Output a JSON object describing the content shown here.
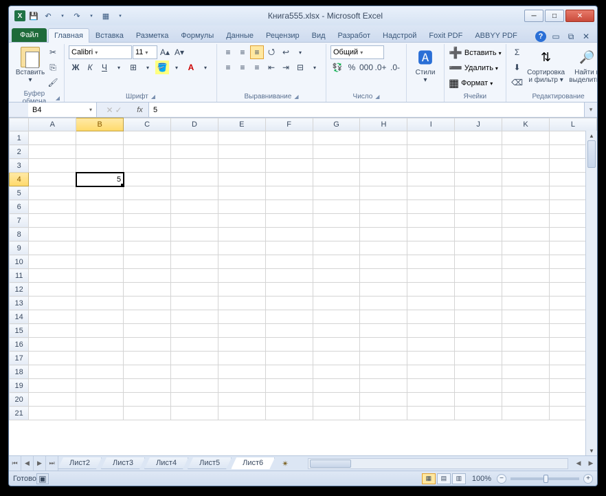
{
  "title": "Книга555.xlsx - Microsoft Excel",
  "file_tab": "Файл",
  "tabs": [
    "Главная",
    "Вставка",
    "Разметка",
    "Формулы",
    "Данные",
    "Рецензир",
    "Вид",
    "Разработ",
    "Надстрой",
    "Foxit PDF",
    "ABBYY PDF"
  ],
  "active_tab_index": 0,
  "ribbon": {
    "clipboard": {
      "paste": "Вставить",
      "label": "Буфер обмена"
    },
    "font": {
      "name": "Calibri",
      "size": "11",
      "label": "Шрифт"
    },
    "alignment": {
      "label": "Выравнивание"
    },
    "number": {
      "format": "Общий",
      "label": "Число"
    },
    "styles": {
      "btn": "Стили",
      "label": ""
    },
    "cells": {
      "insert": "Вставить",
      "delete": "Удалить",
      "format": "Формат",
      "label": "Ячейки"
    },
    "editing": {
      "sort": "Сортировка и фильтр",
      "find": "Найти и выделить",
      "label": "Редактирование"
    }
  },
  "formula_bar": {
    "cell_ref": "B4",
    "value": "5"
  },
  "grid": {
    "columns": [
      "A",
      "B",
      "C",
      "D",
      "E",
      "F",
      "G",
      "H",
      "I",
      "J",
      "K",
      "L"
    ],
    "rows": 21,
    "selected": {
      "row": 4,
      "col": "B"
    },
    "cells": {
      "B4": "5"
    }
  },
  "sheets": {
    "tabs": [
      "Лист2",
      "Лист3",
      "Лист4",
      "Лист5",
      "Лист6"
    ],
    "active_index": 4
  },
  "status": {
    "ready": "Готово",
    "zoom": "100%"
  }
}
